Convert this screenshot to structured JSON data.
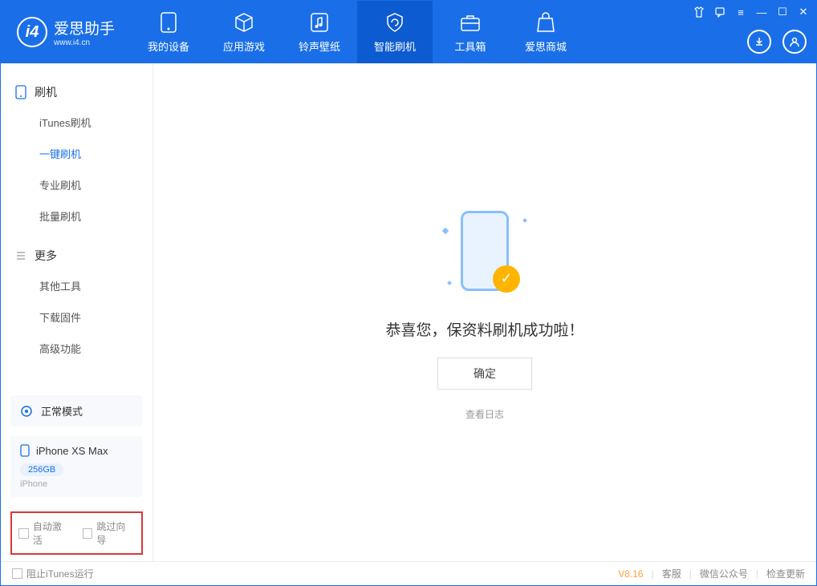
{
  "app": {
    "title": "爱思助手",
    "sub": "www.i4.cn"
  },
  "tabs": [
    {
      "label": "我的设备"
    },
    {
      "label": "应用游戏"
    },
    {
      "label": "铃声壁纸"
    },
    {
      "label": "智能刷机"
    },
    {
      "label": "工具箱"
    },
    {
      "label": "爱思商城"
    }
  ],
  "sidebar": {
    "group1": {
      "title": "刷机",
      "items": [
        "iTunes刷机",
        "一键刷机",
        "专业刷机",
        "批量刷机"
      ]
    },
    "group2": {
      "title": "更多",
      "items": [
        "其他工具",
        "下载固件",
        "高级功能"
      ]
    }
  },
  "deviceMode": "正常模式",
  "device": {
    "name": "iPhone XS Max",
    "storage": "256GB",
    "type": "iPhone"
  },
  "checks": {
    "auto": "自动激活",
    "skip": "跳过向导"
  },
  "main": {
    "msg": "恭喜您，保资料刷机成功啦！",
    "ok": "确定",
    "log": "查看日志"
  },
  "footer": {
    "block": "阻止iTunes运行",
    "version": "V8.16",
    "support": "客服",
    "wechat": "微信公众号",
    "update": "检查更新"
  }
}
